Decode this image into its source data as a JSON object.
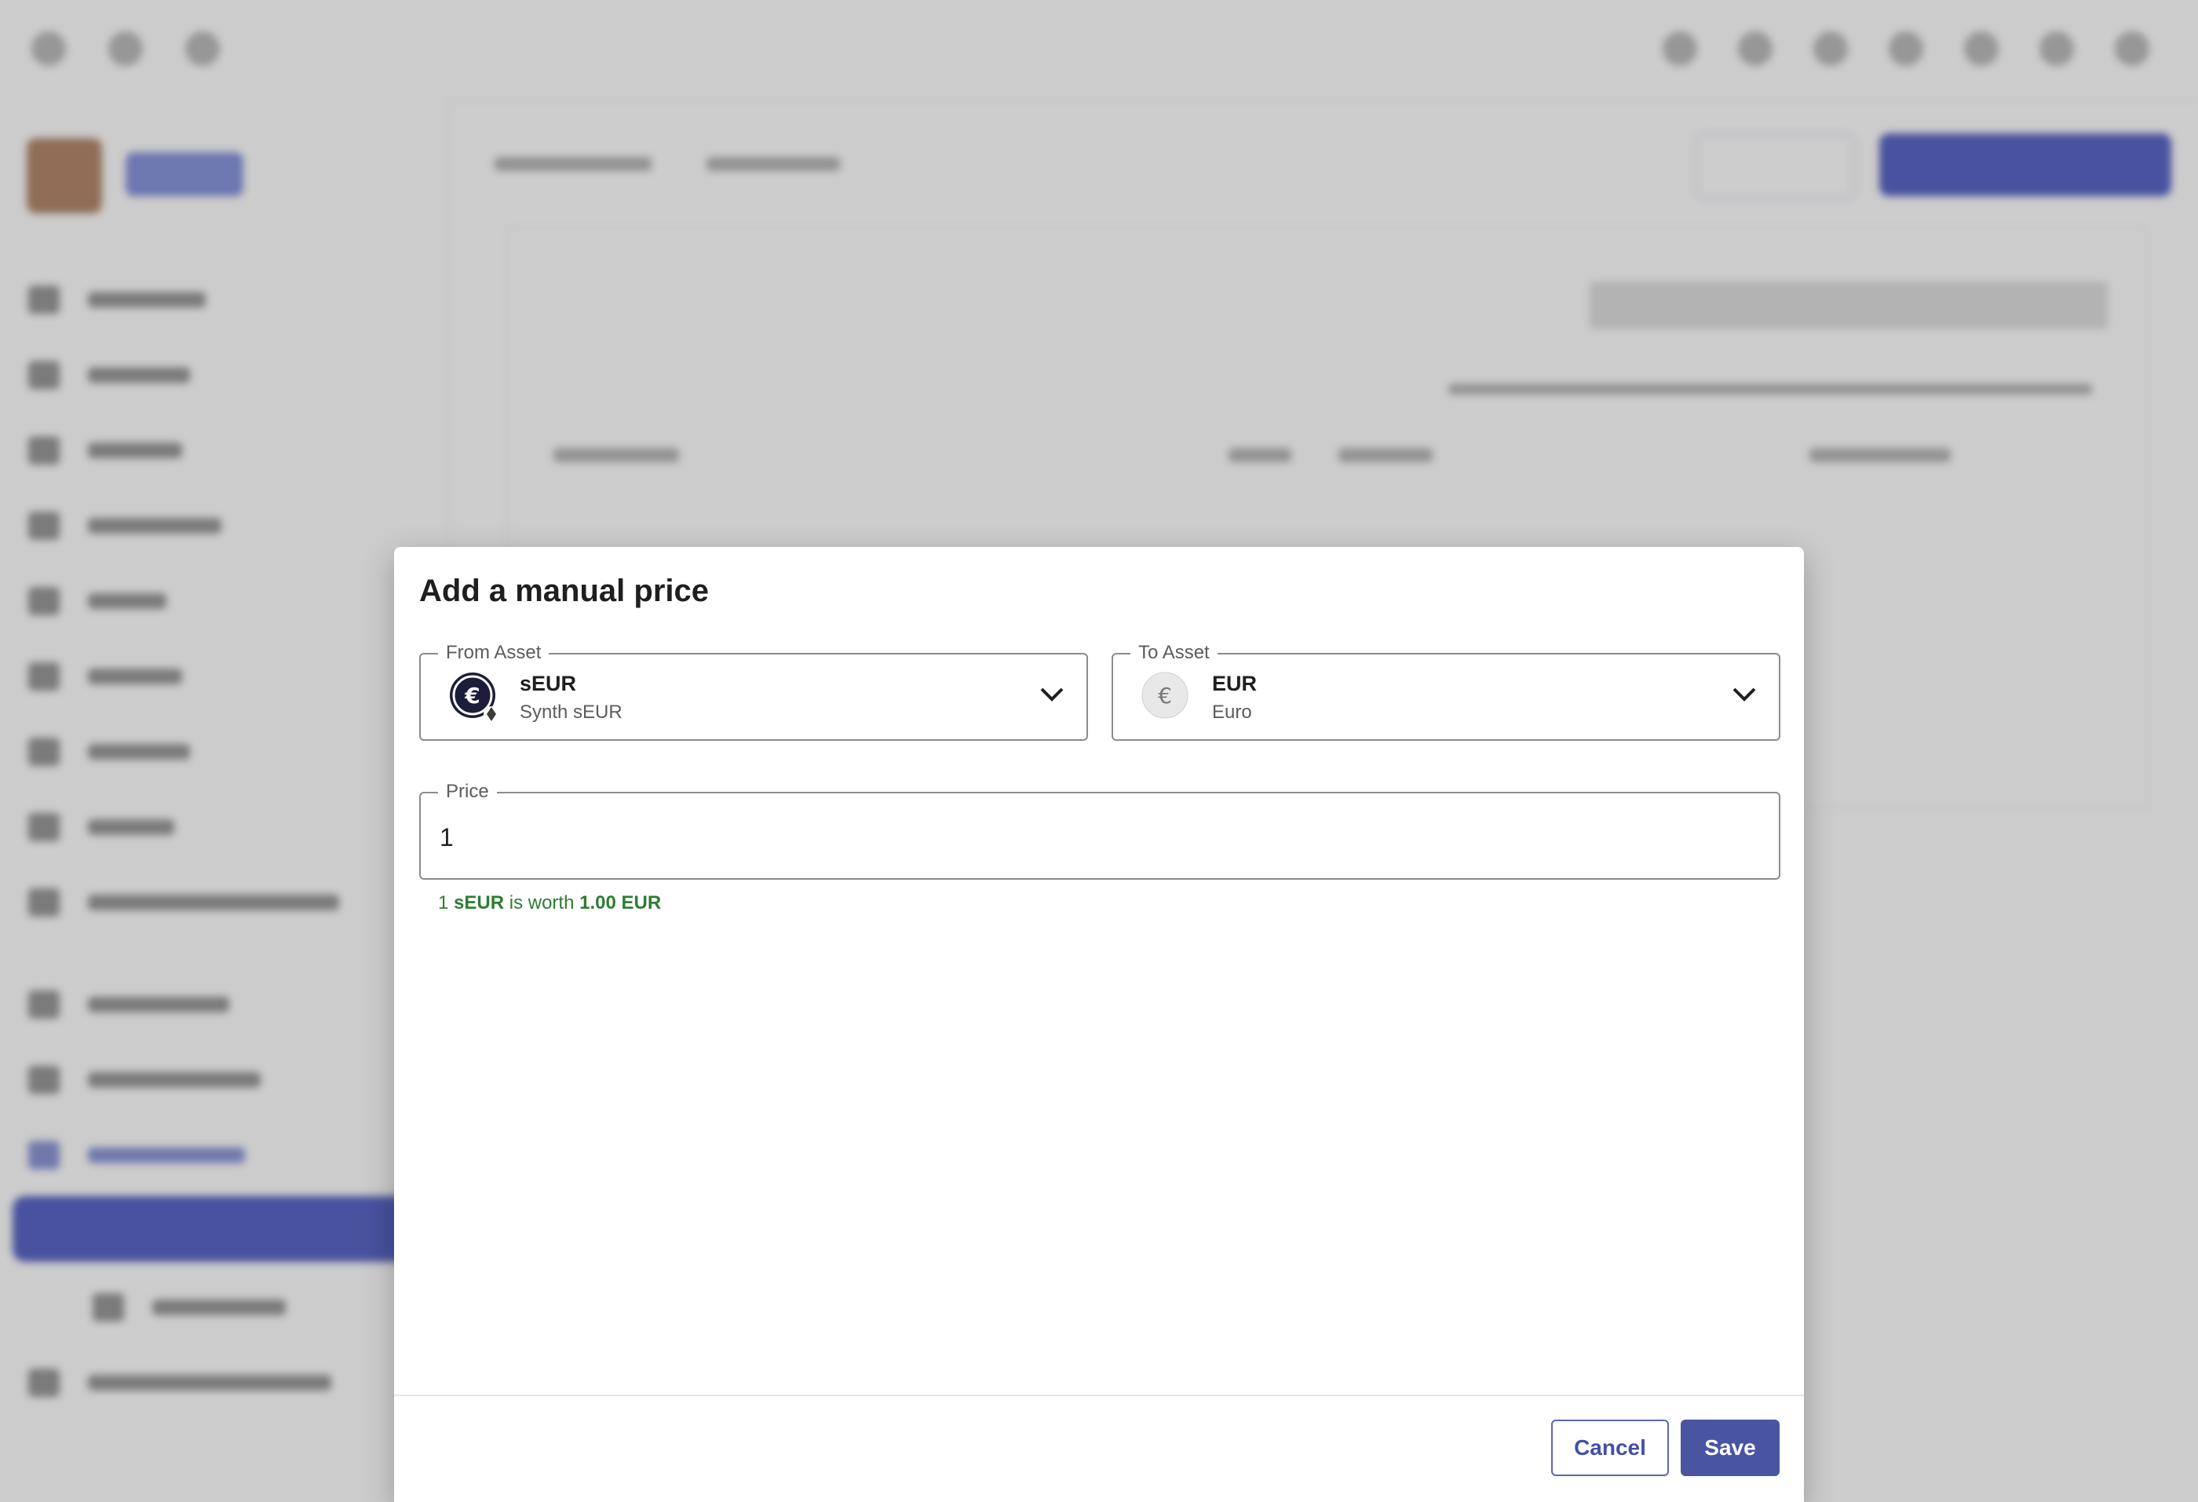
{
  "dialog": {
    "title": "Add a manual price",
    "from_asset": {
      "legend": "From Asset",
      "symbol": "sEUR",
      "name": "Synth sEUR",
      "icon": "seur-coin-icon"
    },
    "to_asset": {
      "legend": "To Asset",
      "symbol": "EUR",
      "name": "Euro",
      "icon": "euro-icon"
    },
    "price": {
      "legend": "Price",
      "value": "1"
    },
    "hint": {
      "amount": "1",
      "from_symbol": "sEUR",
      "middle": "is worth",
      "converted": "1.00 EUR"
    },
    "actions": {
      "cancel_label": "Cancel",
      "save_label": "Save"
    }
  },
  "colors": {
    "primary": "#4a55a2",
    "hint_green": "#2e7d32",
    "scrim": "rgba(0,0,0,0.2)"
  }
}
